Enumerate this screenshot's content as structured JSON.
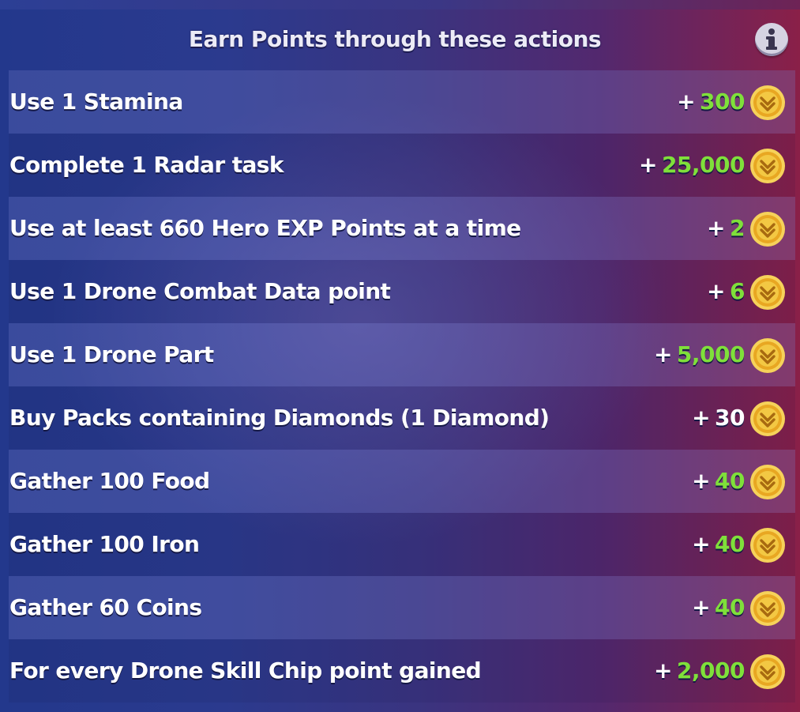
{
  "header": {
    "title": "Earn Points through these actions",
    "info_icon": "info-icon"
  },
  "colors": {
    "reward_green": "#7fe03a",
    "reward_white": "#ffffff",
    "coin_gold": "#f0b62a"
  },
  "actions": [
    {
      "label": "Use 1 Stamina",
      "plus": "+",
      "amount": "300",
      "amount_color": "green",
      "icon": "point-coin-icon"
    },
    {
      "label": "Complete 1 Radar task",
      "plus": "+",
      "amount": "25,000",
      "amount_color": "green",
      "icon": "point-coin-icon"
    },
    {
      "label": "Use at least 660 Hero EXP Points at a time",
      "plus": "+",
      "amount": "2",
      "amount_color": "green",
      "icon": "point-coin-icon"
    },
    {
      "label": "Use 1 Drone Combat Data point",
      "plus": "+",
      "amount": "6",
      "amount_color": "green",
      "icon": "point-coin-icon"
    },
    {
      "label": "Use 1 Drone Part",
      "plus": "+",
      "amount": "5,000",
      "amount_color": "green",
      "icon": "point-coin-icon"
    },
    {
      "label": "Buy Packs containing Diamonds (1 Diamond)",
      "plus": "+",
      "amount": "30",
      "amount_color": "white",
      "icon": "point-coin-icon"
    },
    {
      "label": "Gather 100 Food",
      "plus": "+",
      "amount": "40",
      "amount_color": "green",
      "icon": "point-coin-icon"
    },
    {
      "label": "Gather 100 Iron",
      "plus": "+",
      "amount": "40",
      "amount_color": "green",
      "icon": "point-coin-icon"
    },
    {
      "label": "Gather 60 Coins",
      "plus": "+",
      "amount": "40",
      "amount_color": "green",
      "icon": "point-coin-icon"
    },
    {
      "label": "For every Drone Skill Chip point gained",
      "plus": "+",
      "amount": "2,000",
      "amount_color": "green",
      "icon": "point-coin-icon"
    }
  ]
}
